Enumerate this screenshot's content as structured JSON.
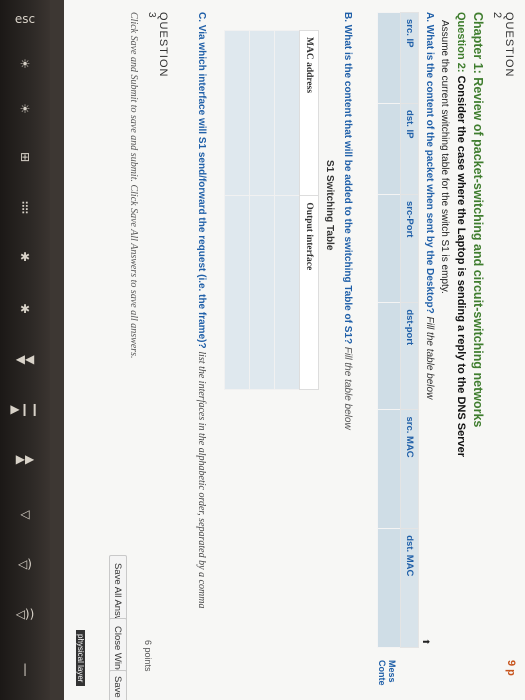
{
  "keyboard": {
    "esc_label": "esc",
    "keys": [
      "☀",
      "☀",
      "⊞",
      "⣿",
      "✱",
      "✱",
      "◀◀",
      "▶❙❙",
      "▶▶",
      "◁",
      "◁)",
      "◁))",
      "|"
    ]
  },
  "question": {
    "label": "QUESTION",
    "number": "2",
    "points_label": "9 p",
    "chapter_title": "Chapter 1: Review of packet-switching and circuit-switching networks",
    "q2_label": "Question 2:",
    "q2_text": "Consider the case where the Laptop is sending a reply to the DNS Server",
    "assume_text": "Assume the current switching table for the switch S1 is empty.",
    "partA": {
      "label": "A. What is the content of the packet when sent by the Desktop?",
      "hint": "Fill the table below",
      "columns": [
        "src. IP",
        "dst. IP",
        "src-Port",
        "dst-port",
        "src. MAC",
        "dst. MAC"
      ]
    },
    "partB": {
      "label": "B. What is the content that will be added to the switching Table of S1?",
      "hint": "Fill the table below",
      "table_title": "S1 Switching Table",
      "columns": [
        "MAC address",
        "Output interface"
      ]
    },
    "partC": {
      "label": "C. Via which interface will S1 send/forward the request (i.e. the frame)?",
      "hint": "list the interfaces in the alphabetic order, separated by a comma"
    },
    "side_link": "Mess Conte"
  },
  "next_question": {
    "label": "QUESTION",
    "number": "3",
    "points": "6 points"
  },
  "footer": {
    "instructions": "Click Save and Submit to save and submit. Click Save All Answers to save all answers.",
    "save_all_label": "Save All Answers",
    "close_window_label": "Close Window",
    "save_label": "Save"
  },
  "corner_tag": "physical layer"
}
